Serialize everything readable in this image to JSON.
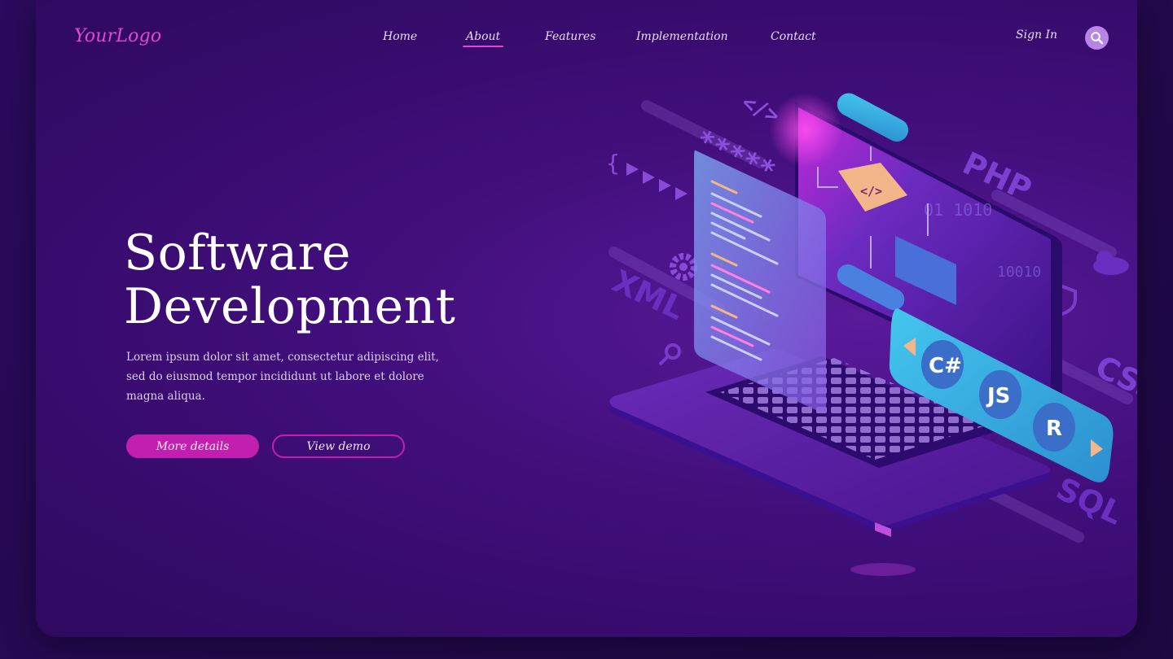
{
  "header": {
    "logo": "YourLogo",
    "nav": [
      {
        "label": "Home",
        "active": false
      },
      {
        "label": "About",
        "active": true
      },
      {
        "label": "Features",
        "active": false
      },
      {
        "label": "Implementation",
        "active": false
      },
      {
        "label": "Contact",
        "active": false
      }
    ],
    "signin": "Sign In",
    "search_icon": "search-icon"
  },
  "hero": {
    "title_line1": "Software",
    "title_line2": "Development",
    "description": "Lorem ipsum dolor sit amet, consectetur adipiscing elit, sed do eiusmod tempor incididunt ut labore et dolore magna aliqua.",
    "primary_button": "More details",
    "secondary_button": "View demo"
  },
  "illustration": {
    "languages": [
      "C#",
      "JS",
      "R"
    ],
    "floating_labels": [
      "PHP",
      "XML",
      "CSS",
      "SQL"
    ],
    "code_tag": "</>",
    "password_mask": "*****"
  },
  "colors": {
    "accent": "#c21fb0",
    "logo": "#e04ad0",
    "background": "#420f7d",
    "panel_cyan": "#3ab8e0"
  }
}
